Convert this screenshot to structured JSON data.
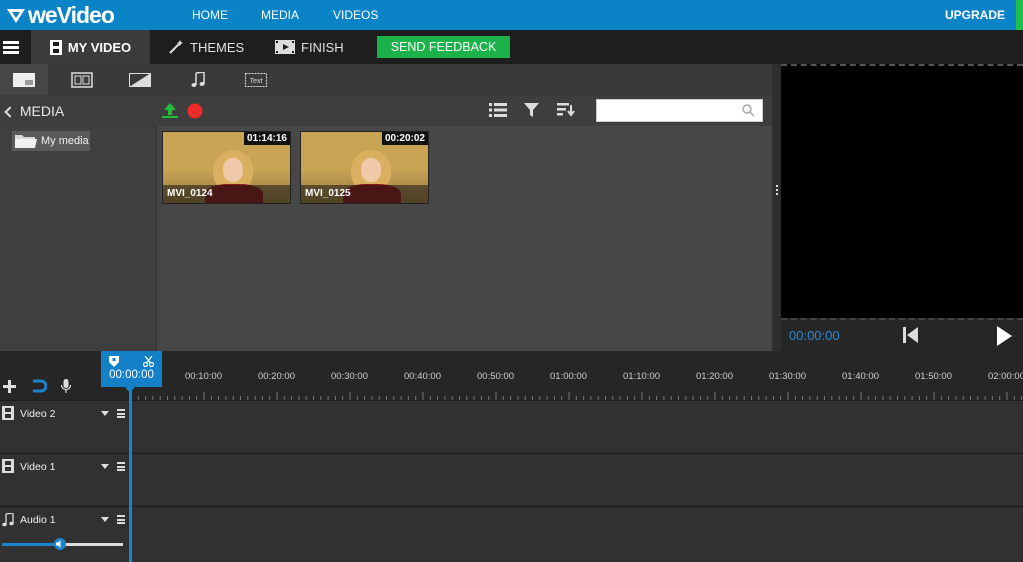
{
  "topbar": {
    "logo_text": "weVideo",
    "nav": [
      "HOME",
      "MEDIA",
      "VIDEOS"
    ],
    "upgrade_label": "UPGRADE"
  },
  "menubar": {
    "tabs": [
      {
        "label": "MY VIDEO",
        "icon": "film-strip-icon"
      },
      {
        "label": "THEMES",
        "icon": "magic-wand-icon"
      },
      {
        "label": "FINISH",
        "icon": "clapperboard-icon"
      }
    ],
    "feedback_label": "SEND FEEDBACK"
  },
  "library": {
    "tabs": [
      "media-tab-icon",
      "transitions-tab-icon",
      "effects-tab-icon",
      "music-tab-icon",
      "text-tab-icon"
    ],
    "text_tab_glyph": "Text",
    "header_label": "MEDIA",
    "search": {
      "value": "",
      "placeholder": ""
    },
    "folders": [
      {
        "label": "My media"
      }
    ],
    "items": [
      {
        "name": "MVI_0124",
        "duration": "01:14:16"
      },
      {
        "name": "MVI_0125",
        "duration": "00:20:02"
      }
    ]
  },
  "preview": {
    "time": "00:00:00"
  },
  "timeline": {
    "playhead_time": "00:00:00",
    "ticks": [
      "00:10:00",
      "00:20:00",
      "00:30:00",
      "00:40:00",
      "00:50:00",
      "01:00:00",
      "01:10:00",
      "01:20:00",
      "01:30:00",
      "01:40:00",
      "01:50:00",
      "02:00:00"
    ],
    "tracks": [
      {
        "name": "Video 2",
        "kind": "video"
      },
      {
        "name": "Video 1",
        "kind": "video"
      },
      {
        "name": "Audio 1",
        "kind": "audio"
      }
    ],
    "audio_volume": 0.48
  },
  "colors": {
    "brand_blue": "#0a84c6",
    "feedback_green": "#1cb24a",
    "playhead_blue": "#1480c8"
  }
}
